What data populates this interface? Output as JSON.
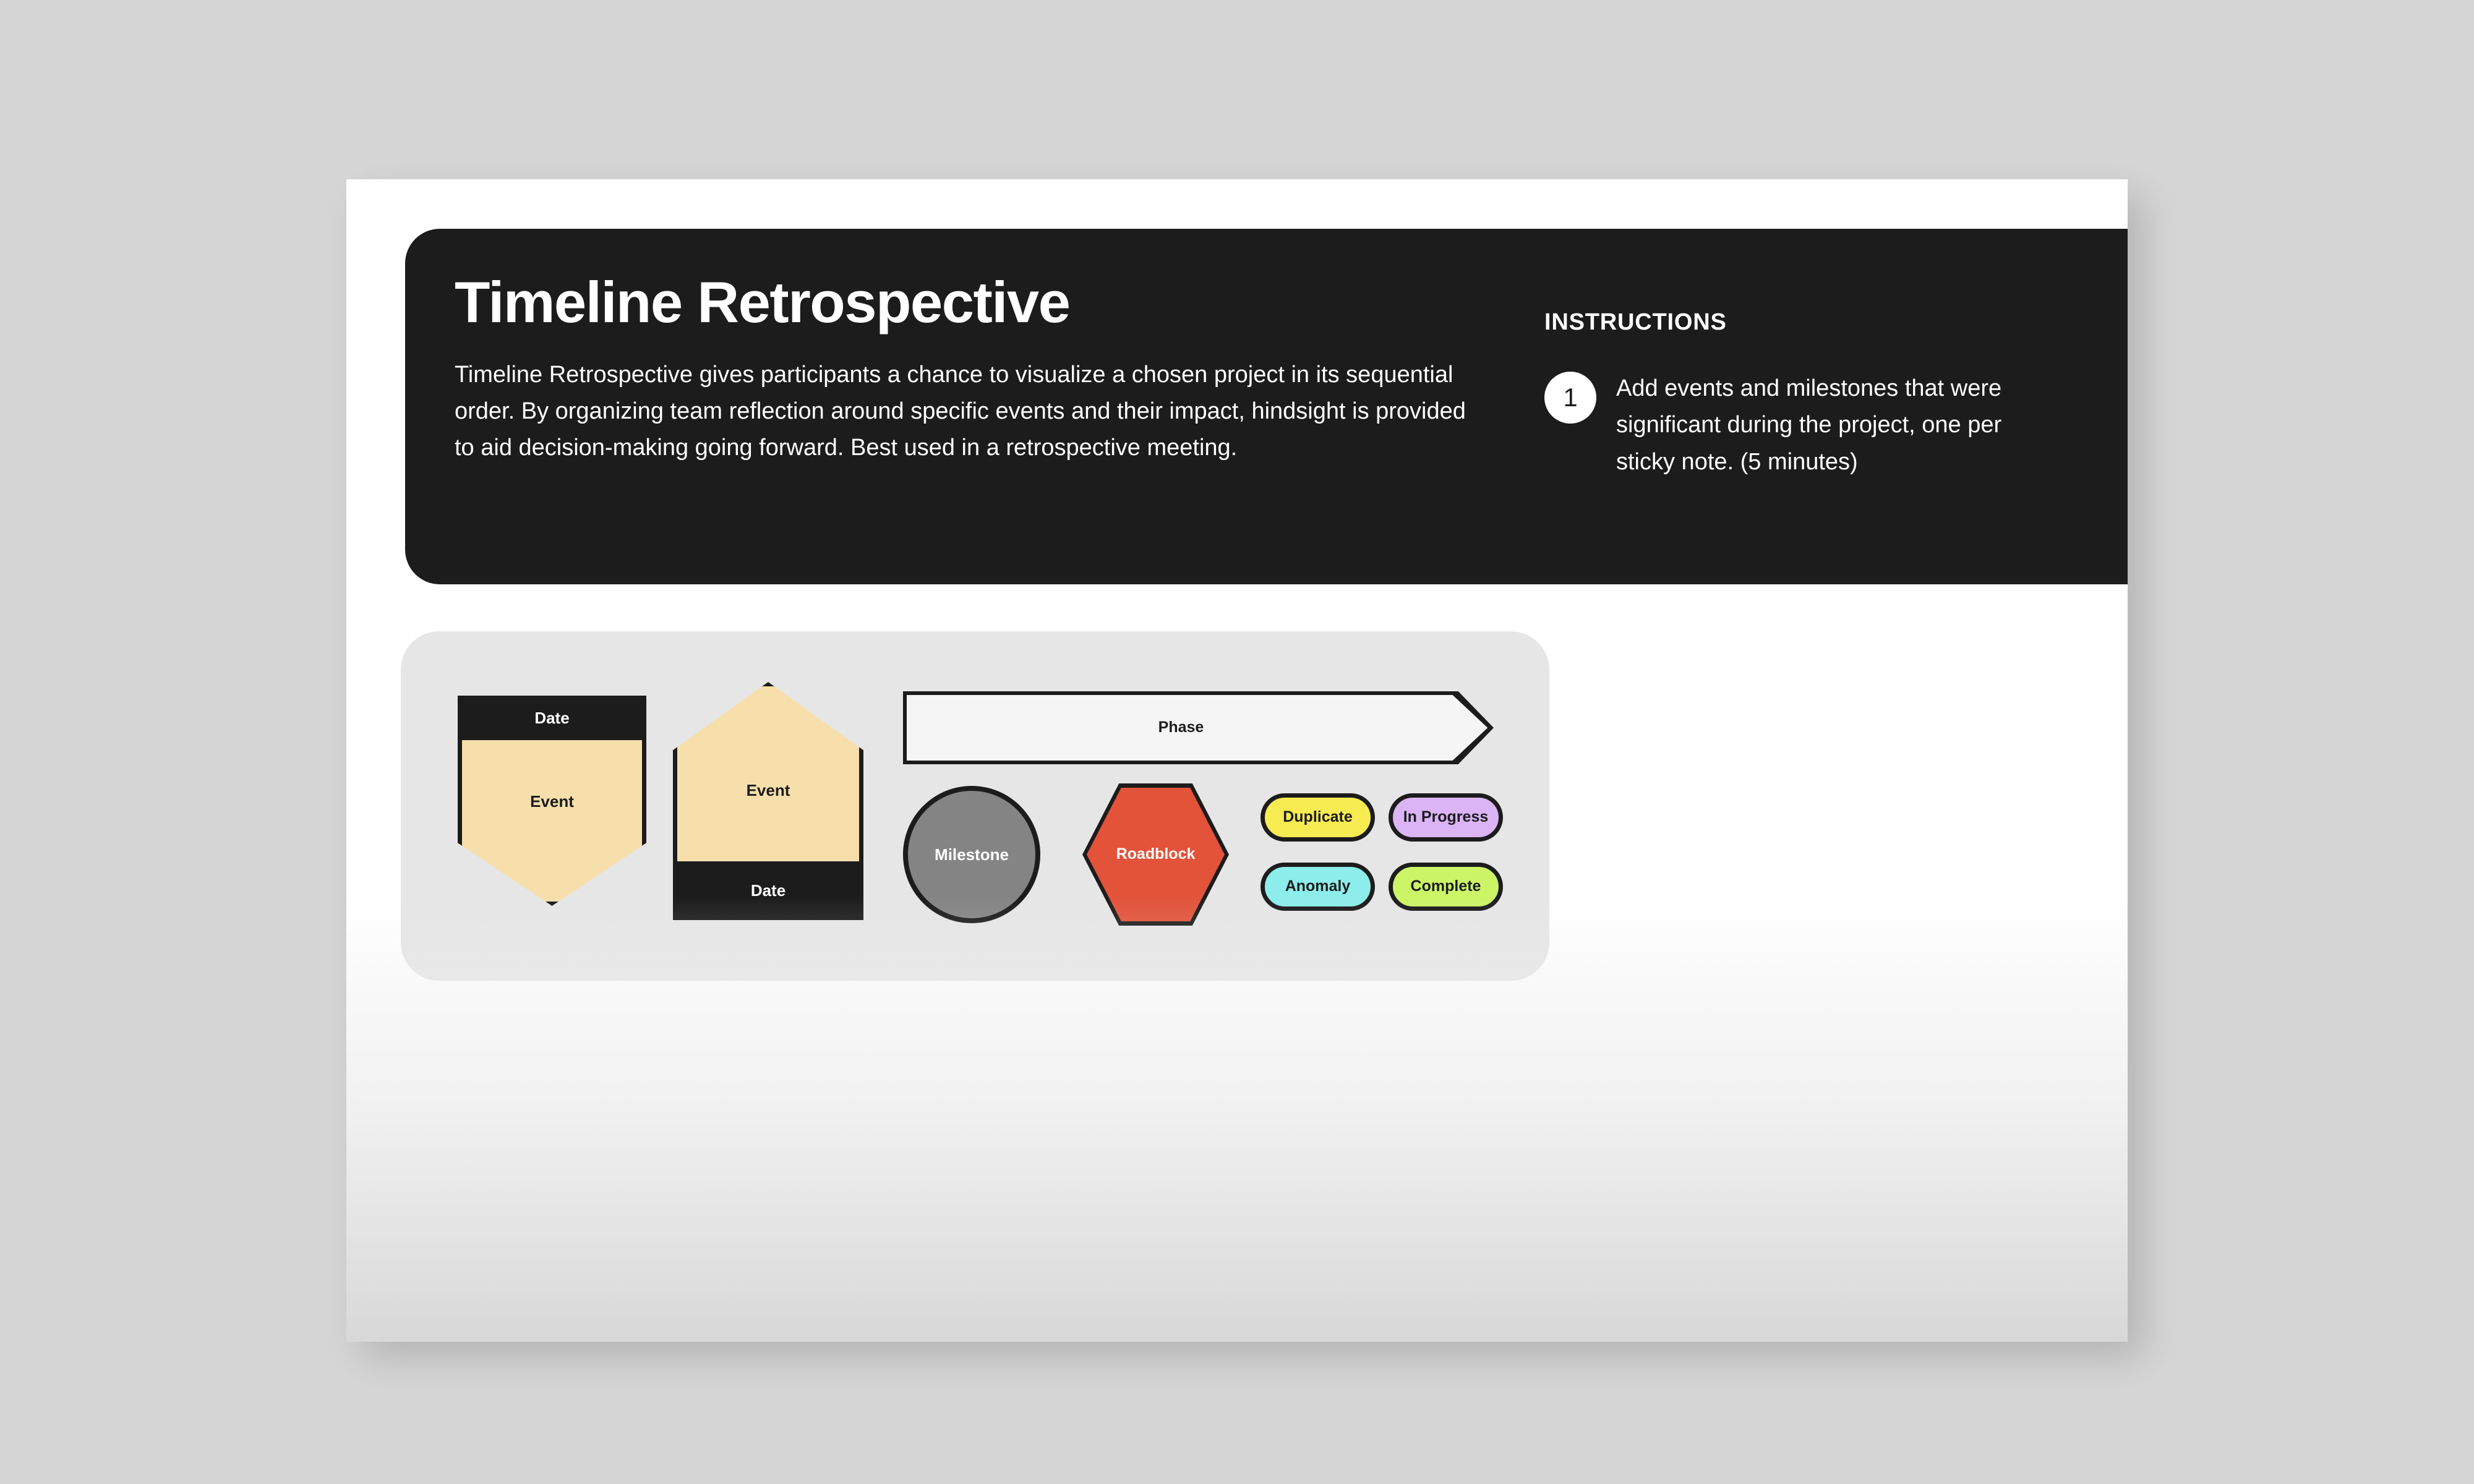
{
  "page": {
    "header": {
      "title": "Timeline Retrospective",
      "description": "Timeline Retrospective gives participants a chance to visualize a chosen project in its sequential order. By organizing team reflection around specific events and their impact, hindsight is provided to aid decision-making going forward. Best used in a retrospective meeting.",
      "background_color": "#1c1c1c",
      "text_color": "#ffffff"
    },
    "instructions": {
      "heading": "INSTRUCTIONS",
      "steps": [
        {
          "number": "1",
          "text": "Add events and milestones that were significant during the project, one per sticky note. (5 minutes)"
        }
      ]
    },
    "shapes_panel": {
      "background_color": "#e6e6e6",
      "event_card_top": {
        "date_label": "Date",
        "event_label": "Event",
        "fill_color": "#f7dfac",
        "header_color": "#1c1c1c",
        "outline_color": "#1c1c1c"
      },
      "event_card_bottom": {
        "date_label": "Date",
        "event_label": "Event",
        "fill_color": "#f7dfac",
        "footer_color": "#1c1c1c",
        "outline_color": "#1c1c1c"
      },
      "phase_banner": {
        "label": "Phase",
        "fill_color": "#f5f5f5",
        "outline_color": "#1c1c1c"
      },
      "milestone": {
        "label": "Milestone",
        "fill_color": "#848484",
        "outline_color": "#1c1c1c",
        "text_color": "#ffffff"
      },
      "roadblock": {
        "label": "Roadblock",
        "fill_color": "#e2533a",
        "outline_color": "#1c1c1c",
        "text_color": "#ffffff"
      },
      "status_pills": [
        {
          "label": "Duplicate",
          "fill_color": "#f7eb52"
        },
        {
          "label": "In Progress",
          "fill_color": "#dbb4f5"
        },
        {
          "label": "Anomaly",
          "fill_color": "#8cedea"
        },
        {
          "label": "Complete",
          "fill_color": "#ccf467"
        }
      ]
    }
  }
}
